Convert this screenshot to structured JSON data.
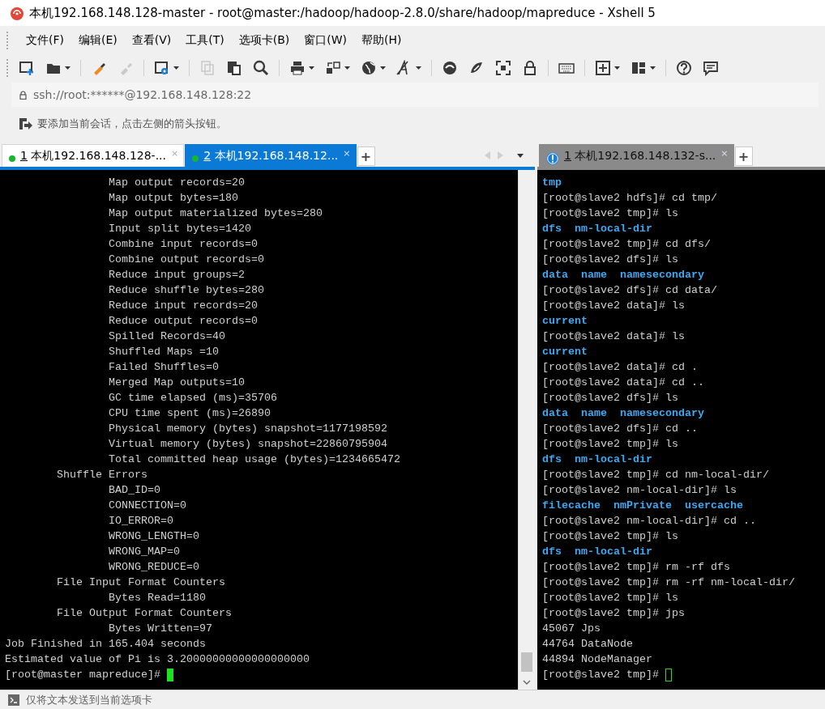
{
  "window": {
    "title": "本机192.168.148.128-master - root@master:/hadoop/hadoop-2.8.0/share/hadoop/mapreduce - Xshell 5"
  },
  "menu": [
    "文件(F)",
    "编辑(E)",
    "查看(V)",
    "工具(T)",
    "选项卡(B)",
    "窗口(W)",
    "帮助(H)"
  ],
  "toolbar": [
    {
      "kind": "new-session",
      "disabled": false,
      "dropdown": false
    },
    {
      "kind": "folder",
      "disabled": false,
      "dropdown": true
    },
    {
      "kind": "connect",
      "disabled": false,
      "dropdown": false
    },
    {
      "kind": "disconnect",
      "disabled": true,
      "dropdown": false
    },
    {
      "kind": "properties",
      "disabled": false,
      "dropdown": true
    },
    {
      "kind": "copy",
      "disabled": true,
      "dropdown": false
    },
    {
      "kind": "paste",
      "disabled": false,
      "dropdown": false
    },
    {
      "kind": "find",
      "disabled": false,
      "dropdown": false
    },
    {
      "kind": "print",
      "disabled": false,
      "dropdown": true
    },
    {
      "kind": "transfer",
      "disabled": false,
      "dropdown": true
    },
    {
      "kind": "globe",
      "disabled": false,
      "dropdown": true
    },
    {
      "kind": "font",
      "disabled": false,
      "dropdown": true
    },
    {
      "kind": "xftp",
      "disabled": false,
      "dropdown": false
    },
    {
      "kind": "xshell",
      "disabled": false,
      "dropdown": false
    },
    {
      "kind": "fullscreen",
      "disabled": false,
      "dropdown": false
    },
    {
      "kind": "lock",
      "disabled": false,
      "dropdown": false
    },
    {
      "kind": "keyboard",
      "disabled": false,
      "dropdown": false
    },
    {
      "kind": "add",
      "disabled": false,
      "dropdown": true
    },
    {
      "kind": "layout",
      "disabled": false,
      "dropdown": true
    },
    {
      "kind": "help",
      "disabled": false,
      "dropdown": false
    },
    {
      "kind": "chat",
      "disabled": false,
      "dropdown": false
    }
  ],
  "address": "ssh://root:******@192.168.148.128:22",
  "hint": "要添加当前会话，点击左侧的箭头按钮。",
  "left_pane": {
    "tabs": [
      {
        "number": "1",
        "label": "本机192.168.148.128-...",
        "close": "×",
        "kind": "connected",
        "selected": false
      },
      {
        "number": "2",
        "label": "本机192.168.148.12...",
        "close": "×",
        "kind": "connected",
        "selected": true
      }
    ],
    "add_tab": "+",
    "cursor_focused": true,
    "lines": [
      {
        "text": "                Map output records=20",
        "kind": "plain"
      },
      {
        "text": "                Map output bytes=180",
        "kind": "plain"
      },
      {
        "text": "                Map output materialized bytes=280",
        "kind": "plain"
      },
      {
        "text": "                Input split bytes=1420",
        "kind": "plain"
      },
      {
        "text": "                Combine input records=0",
        "kind": "plain"
      },
      {
        "text": "                Combine output records=0",
        "kind": "plain"
      },
      {
        "text": "                Reduce input groups=2",
        "kind": "plain"
      },
      {
        "text": "                Reduce shuffle bytes=280",
        "kind": "plain"
      },
      {
        "text": "                Reduce input records=20",
        "kind": "plain"
      },
      {
        "text": "                Reduce output records=0",
        "kind": "plain"
      },
      {
        "text": "                Spilled Records=40",
        "kind": "plain"
      },
      {
        "text": "                Shuffled Maps =10",
        "kind": "plain"
      },
      {
        "text": "                Failed Shuffles=0",
        "kind": "plain"
      },
      {
        "text": "                Merged Map outputs=10",
        "kind": "plain"
      },
      {
        "text": "                GC time elapsed (ms)=35706",
        "kind": "plain"
      },
      {
        "text": "                CPU time spent (ms)=26890",
        "kind": "plain"
      },
      {
        "text": "                Physical memory (bytes) snapshot=1177198592",
        "kind": "plain"
      },
      {
        "text": "                Virtual memory (bytes) snapshot=22860795904",
        "kind": "plain"
      },
      {
        "text": "                Total committed heap usage (bytes)=1234665472",
        "kind": "plain"
      },
      {
        "text": "        Shuffle Errors",
        "kind": "plain"
      },
      {
        "text": "                BAD_ID=0",
        "kind": "plain"
      },
      {
        "text": "                CONNECTION=0",
        "kind": "plain"
      },
      {
        "text": "                IO_ERROR=0",
        "kind": "plain"
      },
      {
        "text": "                WRONG_LENGTH=0",
        "kind": "plain"
      },
      {
        "text": "                WRONG_MAP=0",
        "kind": "plain"
      },
      {
        "text": "                WRONG_REDUCE=0",
        "kind": "plain"
      },
      {
        "text": "        File Input Format Counters",
        "kind": "plain"
      },
      {
        "text": "                Bytes Read=1180",
        "kind": "plain"
      },
      {
        "text": "        File Output Format Counters",
        "kind": "plain"
      },
      {
        "text": "                Bytes Written=97",
        "kind": "plain"
      },
      {
        "text": "Job Finished in 165.404 seconds",
        "kind": "plain"
      },
      {
        "text": "Estimated value of Pi is 3.20000000000000000000",
        "kind": "plain"
      },
      {
        "text": "[root@master mapreduce]# ",
        "kind": "prompt"
      }
    ]
  },
  "right_pane": {
    "tabs": [
      {
        "number": "1",
        "label": "本机192.168.148.132-s...",
        "close": "×",
        "kind": "alert",
        "selected": true
      }
    ],
    "add_tab": "+",
    "cursor_focused": false,
    "lines": [
      {
        "text": "tmp",
        "kind": "dir"
      },
      {
        "text": "[root@slave2 hdfs]# cd tmp/",
        "kind": "plain"
      },
      {
        "text": "[root@slave2 tmp]# ls",
        "kind": "plain"
      },
      {
        "text": "dfs  nm-local-dir",
        "kind": "dir"
      },
      {
        "text": "[root@slave2 tmp]# cd dfs/",
        "kind": "plain"
      },
      {
        "text": "[root@slave2 dfs]# ls",
        "kind": "plain"
      },
      {
        "text": "data  name  namesecondary",
        "kind": "dir"
      },
      {
        "text": "[root@slave2 dfs]# cd data/",
        "kind": "plain"
      },
      {
        "text": "[root@slave2 data]# ls",
        "kind": "plain"
      },
      {
        "text": "current",
        "kind": "dir"
      },
      {
        "text": "[root@slave2 data]# ls",
        "kind": "plain"
      },
      {
        "text": "current",
        "kind": "dir"
      },
      {
        "text": "[root@slave2 data]# cd .",
        "kind": "plain"
      },
      {
        "text": "[root@slave2 data]# cd ..",
        "kind": "plain"
      },
      {
        "text": "[root@slave2 dfs]# ls",
        "kind": "plain"
      },
      {
        "text": "data  name  namesecondary",
        "kind": "dir"
      },
      {
        "text": "[root@slave2 dfs]# cd ..",
        "kind": "plain"
      },
      {
        "text": "[root@slave2 tmp]# ls",
        "kind": "plain"
      },
      {
        "text": "dfs  nm-local-dir",
        "kind": "dir"
      },
      {
        "text": "[root@slave2 tmp]# cd nm-local-dir/",
        "kind": "plain"
      },
      {
        "text": "[root@slave2 nm-local-dir]# ls",
        "kind": "plain"
      },
      {
        "text": "filecache  nmPrivate  usercache",
        "kind": "dir"
      },
      {
        "text": "[root@slave2 nm-local-dir]# cd ..",
        "kind": "plain"
      },
      {
        "text": "[root@slave2 tmp]# ls",
        "kind": "plain"
      },
      {
        "text": "dfs  nm-local-dir",
        "kind": "dir"
      },
      {
        "text": "[root@slave2 tmp]# rm -rf dfs",
        "kind": "plain"
      },
      {
        "text": "[root@slave2 tmp]# rm -rf nm-local-dir/",
        "kind": "plain"
      },
      {
        "text": "[root@slave2 tmp]# ls",
        "kind": "plain"
      },
      {
        "text": "[root@slave2 tmp]# jps",
        "kind": "plain"
      },
      {
        "text": "45067 Jps",
        "kind": "plain"
      },
      {
        "text": "44764 DataNode",
        "kind": "plain"
      },
      {
        "text": "44894 NodeManager",
        "kind": "plain"
      },
      {
        "text": "[root@slave2 tmp]# ",
        "kind": "prompt"
      }
    ]
  },
  "status_bar": "仅将文本发送到当前选项卡"
}
